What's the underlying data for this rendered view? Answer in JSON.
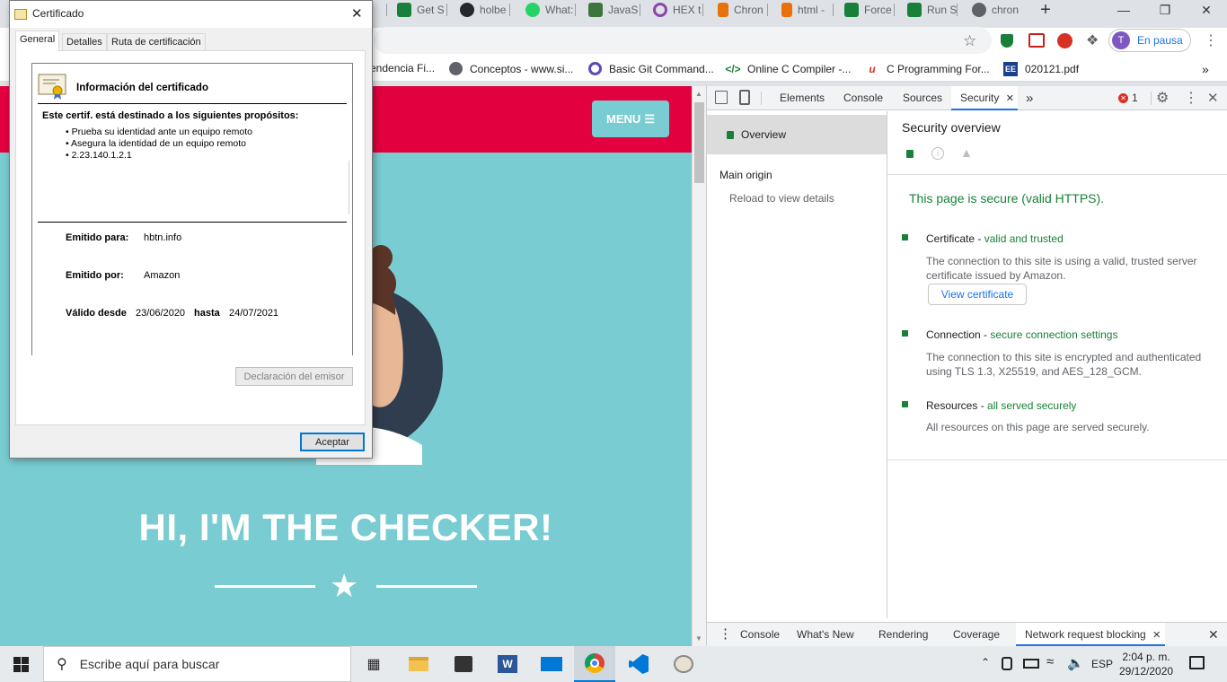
{
  "browser": {
    "tabs": [
      {
        "label": "Get S",
        "color": "#188038"
      },
      {
        "label": "holbe",
        "color": "#24292e"
      },
      {
        "label": "What:",
        "color": "#25d366"
      },
      {
        "label": "JavaS",
        "color": "#3c763d"
      },
      {
        "label": "HEX t",
        "color": "#8e44ad"
      },
      {
        "label": "Chron",
        "color": "#e8710a"
      },
      {
        "label": "html -",
        "color": "#e8710a"
      },
      {
        "label": "Force",
        "color": "#188038"
      },
      {
        "label": "Run S",
        "color": "#188038"
      },
      {
        "label": "chron",
        "color": "#5f6368"
      }
    ],
    "new_tab_label": "+",
    "profile_initial": "T",
    "profile_status": "En pausa",
    "bookmarks": [
      {
        "label": "endencia Fi...",
        "icon": ""
      },
      {
        "label": "Conceptos - www.si...",
        "icon": "globe-icon"
      },
      {
        "label": "Basic Git Command...",
        "icon": "circle-icon"
      },
      {
        "label": "Online C Compiler -...",
        "icon": "code-icon"
      },
      {
        "label": "C Programming For...",
        "icon": "u-icon"
      },
      {
        "label": "020121.pdf",
        "icon": "ee-icon"
      }
    ],
    "bookmarks_more": "»"
  },
  "page": {
    "menu_label": "MENU",
    "hero_title": "HI, I'M THE CHECKER!"
  },
  "devtools": {
    "tabs": [
      "Elements",
      "Console",
      "Sources",
      "Security"
    ],
    "more": "»",
    "error_count": "1",
    "sidebar": {
      "overview": "Overview",
      "main_origin": "Main origin",
      "reload": "Reload to view details"
    },
    "security": {
      "title": "Security overview",
      "secure_message": "This page is secure (valid HTTPS).",
      "certificate_label": "Certificate - ",
      "certificate_status": "valid and trusted",
      "certificate_desc": "The connection to this site is using a valid, trusted server certificate issued by Amazon.",
      "view_certificate": "View certificate",
      "connection_label": "Connection - ",
      "connection_status": "secure connection settings",
      "connection_desc": "The connection to this site is encrypted and authenticated using TLS 1.3, X25519, and AES_128_GCM.",
      "resources_label": "Resources - ",
      "resources_status": "all served securely",
      "resources_desc": "All resources on this page are served securely."
    },
    "drawer_tabs": [
      "Console",
      "What's New",
      "Rendering",
      "Coverage",
      "Network request blocking"
    ]
  },
  "dialog": {
    "title": "Certificado",
    "tabs": [
      "General",
      "Detalles",
      "Ruta de certificación"
    ],
    "info_title": "Información del certificado",
    "purpose_title": "Este certif. está destinado a los siguientes propósitos:",
    "purposes": [
      "• Prueba su identidad ante un equipo remoto",
      "• Asegura la identidad de un equipo remoto",
      "• 2.23.140.1.2.1"
    ],
    "issued_to_label": "Emitido para:",
    "issued_to": "hbtn.info",
    "issued_by_label": "Emitido por:",
    "issued_by": "Amazon",
    "valid_from_label": "Válido desde",
    "valid_from": "23/06/2020",
    "valid_to_label": "hasta",
    "valid_to": "24/07/2021",
    "issuer_statement": "Declaración del emisor",
    "ok": "Aceptar"
  },
  "taskbar": {
    "search_placeholder": "Escribe aquí para buscar",
    "language": "ESP",
    "time": "2:04 p. m.",
    "date": "29/12/2020"
  }
}
